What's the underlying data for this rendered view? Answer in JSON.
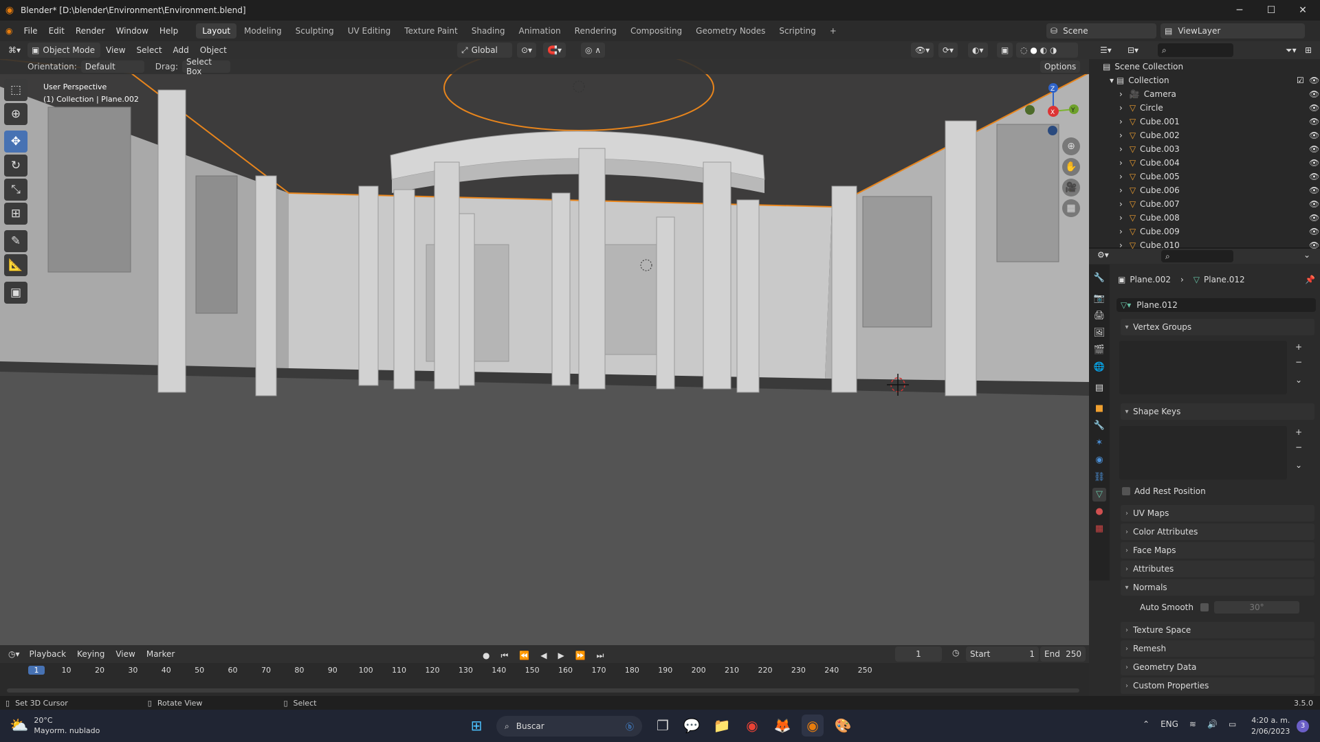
{
  "window": {
    "title": "Blender* [D:\\blender\\Environment\\Environment.blend]"
  },
  "menu": {
    "items": [
      "File",
      "Edit",
      "Render",
      "Window",
      "Help"
    ]
  },
  "workspaces": [
    "Layout",
    "Modeling",
    "Sculpting",
    "UV Editing",
    "Texture Paint",
    "Shading",
    "Animation",
    "Rendering",
    "Compositing",
    "Geometry Nodes",
    "Scripting"
  ],
  "active_workspace": "Layout",
  "scene": {
    "label": "Scene",
    "view_layer": "ViewLayer"
  },
  "viewport": {
    "mode": "Object Mode",
    "menus": [
      "View",
      "Select",
      "Add",
      "Object"
    ],
    "transform_orientation": "Global",
    "orientation_label": "Orientation:",
    "orientation_value": "Default",
    "drag_label": "Drag:",
    "drag_value": "Select Box",
    "options_label": "Options",
    "overlay_line1": "User Perspective",
    "overlay_line2": "(1) Collection | Plane.002",
    "axis": {
      "x": "X",
      "y": "Y",
      "z": "Z"
    }
  },
  "outliner": {
    "root": "Scene Collection",
    "collection": "Collection",
    "items": [
      "Camera",
      "Circle",
      "Cube.001",
      "Cube.002",
      "Cube.003",
      "Cube.004",
      "Cube.005",
      "Cube.006",
      "Cube.007",
      "Cube.008",
      "Cube.009",
      "Cube.010"
    ]
  },
  "properties": {
    "breadcrumb_object": "Plane.002",
    "breadcrumb_data": "Plane.012",
    "datablock": "Plane.012",
    "panels": {
      "vertex_groups": "Vertex Groups",
      "shape_keys": "Shape Keys",
      "add_rest_position": "Add Rest Position",
      "uv_maps": "UV Maps",
      "color_attributes": "Color Attributes",
      "face_maps": "Face Maps",
      "attributes": "Attributes",
      "normals": "Normals",
      "auto_smooth": "Auto Smooth",
      "auto_smooth_angle": "30°",
      "texture_space": "Texture Space",
      "remesh": "Remesh",
      "geometry_data": "Geometry Data",
      "custom_properties": "Custom Properties"
    }
  },
  "timeline": {
    "menus": [
      "Playback",
      "Keying",
      "View",
      "Marker"
    ],
    "current_frame": "1",
    "start_label": "Start",
    "start": "1",
    "end_label": "End",
    "end": "250",
    "ticks": [
      "1",
      "10",
      "20",
      "30",
      "40",
      "50",
      "60",
      "70",
      "80",
      "90",
      "100",
      "110",
      "120",
      "130",
      "140",
      "150",
      "160",
      "170",
      "180",
      "190",
      "200",
      "210",
      "220",
      "230",
      "240",
      "250"
    ]
  },
  "status": {
    "set_cursor": "Set 3D Cursor",
    "rotate_view": "Rotate View",
    "select": "Select",
    "version": "3.5.0"
  },
  "taskbar": {
    "weather_temp": "20°C",
    "weather_desc": "Mayorm. nublado",
    "search": "Buscar",
    "lang": "ENG",
    "time": "4:20 a. m.",
    "date": "2/06/2023",
    "notifications": "3"
  },
  "colors": {
    "accent": "#4772b3",
    "selection": "#e8851c",
    "active_orange": "#ffaf29"
  }
}
